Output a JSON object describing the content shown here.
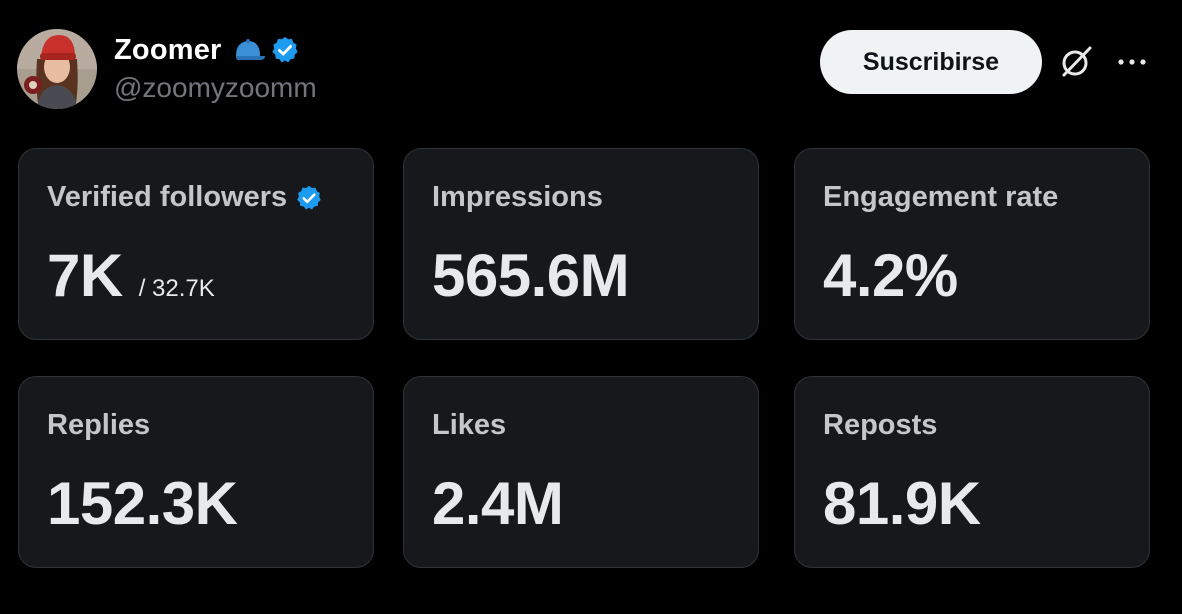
{
  "profile": {
    "display_name": "Zoomer",
    "handle": "@zoomyzoomm",
    "avatar_icon": "profile-photo",
    "name_icons": [
      "cap-icon",
      "verified-badge-icon"
    ],
    "verified_color": "#1d9bf0"
  },
  "actions": {
    "subscribe_label": "Suscribirse",
    "grok_icon": "grok-icon",
    "more_icon": "more-dots-icon"
  },
  "stats": [
    {
      "label": "Verified followers",
      "value": "7K",
      "sub_value": "/ 32.7K",
      "badge": "verified-badge-icon"
    },
    {
      "label": "Impressions",
      "value": "565.6M"
    },
    {
      "label": "Engagement rate",
      "value": "4.2%"
    },
    {
      "label": "Replies",
      "value": "152.3K"
    },
    {
      "label": "Likes",
      "value": "2.4M"
    },
    {
      "label": "Reposts",
      "value": "81.9K"
    }
  ],
  "colors": {
    "background": "#000000",
    "card_background": "#16181c",
    "card_border": "#2f3336",
    "button_background": "#eff3f4",
    "muted_text": "#71767b"
  }
}
